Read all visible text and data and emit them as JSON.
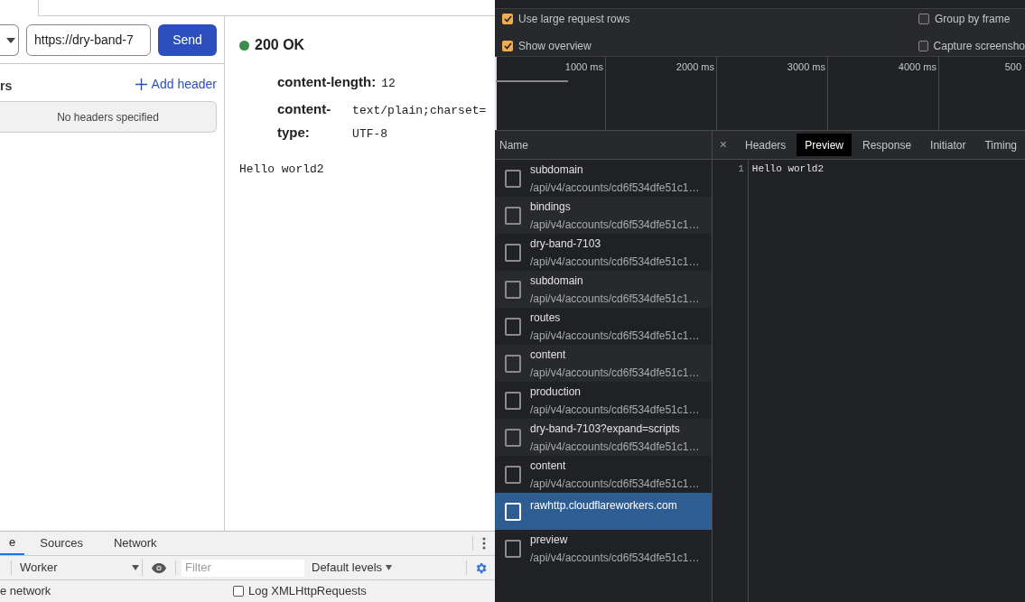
{
  "request": {
    "url": "https://dry-band-7",
    "send": "Send"
  },
  "headers_section": {
    "label": "rs",
    "add": "Add header",
    "empty": "No headers specified"
  },
  "response": {
    "status": "200 OK",
    "headers": [
      {
        "name": "content-length:",
        "value": "12"
      },
      {
        "name": "content-type:",
        "value": "text/plain;charset=UTF-8"
      }
    ],
    "body": "Hello world2"
  },
  "console": {
    "tabs": [
      {
        "label": "e",
        "selected": true
      },
      {
        "label": "Sources",
        "selected": false
      },
      {
        "label": "Network",
        "selected": false
      }
    ],
    "context": "Worker",
    "filter_placeholder": "Filter",
    "levels": "Default levels",
    "preserve_fragment": "e network",
    "log_xhr": {
      "label": "Log XMLHttpRequests",
      "checked": false
    }
  },
  "network": {
    "options": [
      {
        "label": "Use large request rows",
        "checked": true
      },
      {
        "label": "Group by frame",
        "checked": false
      },
      {
        "label": "Show overview",
        "checked": true
      },
      {
        "label": "Capture screensho",
        "checked": false
      }
    ],
    "ticks": [
      "1000 ms",
      "2000 ms",
      "3000 ms",
      "4000 ms",
      "500"
    ],
    "name_header": "Name",
    "requests": [
      {
        "name": "subdomain",
        "path": "/api/v4/accounts/cd6f534dfe51c1…",
        "selected": false
      },
      {
        "name": "bindings",
        "path": "/api/v4/accounts/cd6f534dfe51c1…",
        "selected": false
      },
      {
        "name": "dry-band-7103",
        "path": "/api/v4/accounts/cd6f534dfe51c1…",
        "selected": false
      },
      {
        "name": "subdomain",
        "path": "/api/v4/accounts/cd6f534dfe51c1…",
        "selected": false
      },
      {
        "name": "routes",
        "path": "/api/v4/accounts/cd6f534dfe51c1…",
        "selected": false
      },
      {
        "name": "content",
        "path": "/api/v4/accounts/cd6f534dfe51c1…",
        "selected": false
      },
      {
        "name": "production",
        "path": "/api/v4/accounts/cd6f534dfe51c1…",
        "selected": false
      },
      {
        "name": "dry-band-7103?expand=scripts",
        "path": "/api/v4/accounts/cd6f534dfe51c1…",
        "selected": false
      },
      {
        "name": "content",
        "path": "/api/v4/accounts/cd6f534dfe51c1…",
        "selected": false
      },
      {
        "name": "rawhttp.cloudflareworkers.com",
        "selected": true
      },
      {
        "name": "preview",
        "path": "/api/v4/accounts/cd6f534dfe51c1…",
        "selected": false
      }
    ],
    "close": "×",
    "detail_tabs": [
      {
        "label": "Headers",
        "selected": false
      },
      {
        "label": "Preview",
        "selected": true
      },
      {
        "label": "Response",
        "selected": false
      },
      {
        "label": "Initiator",
        "selected": false
      },
      {
        "label": "Timing",
        "selected": false
      }
    ],
    "preview_lines": [
      {
        "number": "1",
        "text": "Hello world2"
      }
    ]
  }
}
